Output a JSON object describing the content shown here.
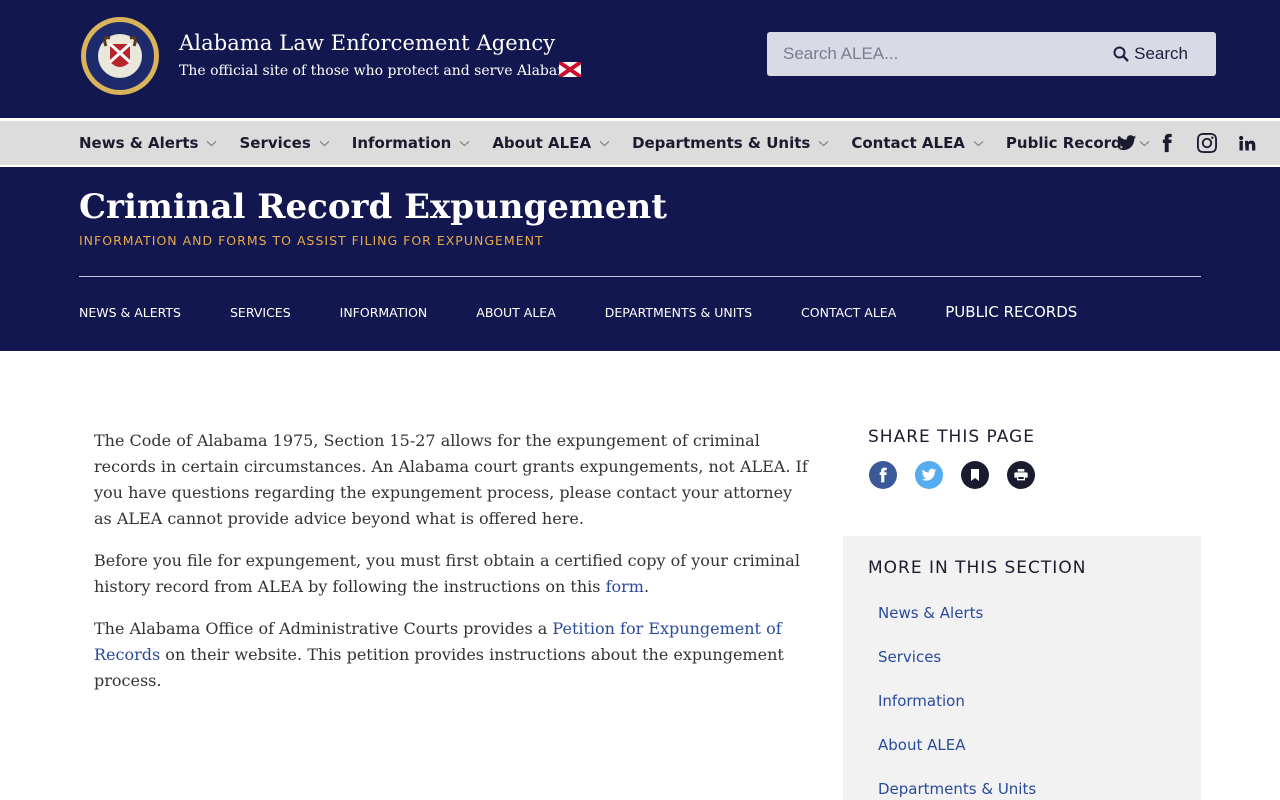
{
  "header": {
    "agency_name": "Alabama Law Enforcement Agency",
    "tagline": "The official site of those who protect and serve Alabama",
    "seal_icon": "state-seal-icon",
    "flag_icon": "alabama-flag-icon",
    "search": {
      "placeholder": "Search ALEA...",
      "value": "",
      "button_label": "Search"
    }
  },
  "main_nav": {
    "items": [
      {
        "label": "News & Alerts"
      },
      {
        "label": "Services"
      },
      {
        "label": "Information"
      },
      {
        "label": "About ALEA"
      },
      {
        "label": "Departments & Units"
      },
      {
        "label": "Contact ALEA"
      },
      {
        "label": "Public Records"
      }
    ],
    "social": [
      "twitter-icon",
      "facebook-icon",
      "instagram-icon",
      "linkedin-icon"
    ]
  },
  "banner": {
    "title": "Criminal Record Expungement",
    "subtitle": "INFORMATION AND FORMS TO ASSIST FILING FOR EXPUNGEMENT",
    "sub_nav": [
      {
        "label": "NEWS & ALERTS"
      },
      {
        "label": "SERVICES"
      },
      {
        "label": "INFORMATION"
      },
      {
        "label": "ABOUT ALEA"
      },
      {
        "label": "DEPARTMENTS & UNITS"
      },
      {
        "label": "CONTACT ALEA"
      },
      {
        "label": "PUBLIC RECORDS"
      }
    ]
  },
  "content": {
    "p1": "The Code of Alabama 1975, Section 15-27 allows for the expungement of criminal records in certain circumstances. An Alabama court grants expungements, not ALEA. If you have questions regarding the expungement process, please contact your attorney as ALEA cannot provide advice beyond what is offered here.",
    "p2_before": "Before you file for expungement, you must first obtain a certified copy of your criminal history record from ALEA by following the instructions on this ",
    "p2_link": "form",
    "p2_after": ".",
    "p3_before": "The Alabama Office of Administrative Courts provides a ",
    "p3_link": "Petition for Expungement of Records",
    "p3_after": " on their website. This petition provides instructions about the expungement process."
  },
  "sidebar": {
    "share_title": "SHARE THIS PAGE",
    "share_icons": [
      "facebook-icon",
      "twitter-icon",
      "bookmark-icon",
      "print-icon"
    ],
    "more_title": "MORE IN THIS SECTION",
    "more_items": [
      {
        "label": "News & Alerts"
      },
      {
        "label": "Services"
      },
      {
        "label": "Information"
      },
      {
        "label": "About ALEA"
      },
      {
        "label": "Departments & Units"
      }
    ]
  },
  "colors": {
    "navy": "#13174f",
    "gold": "#e8a94a",
    "nav_gray": "#dcdcdc",
    "link_blue": "#2a4a9b"
  }
}
